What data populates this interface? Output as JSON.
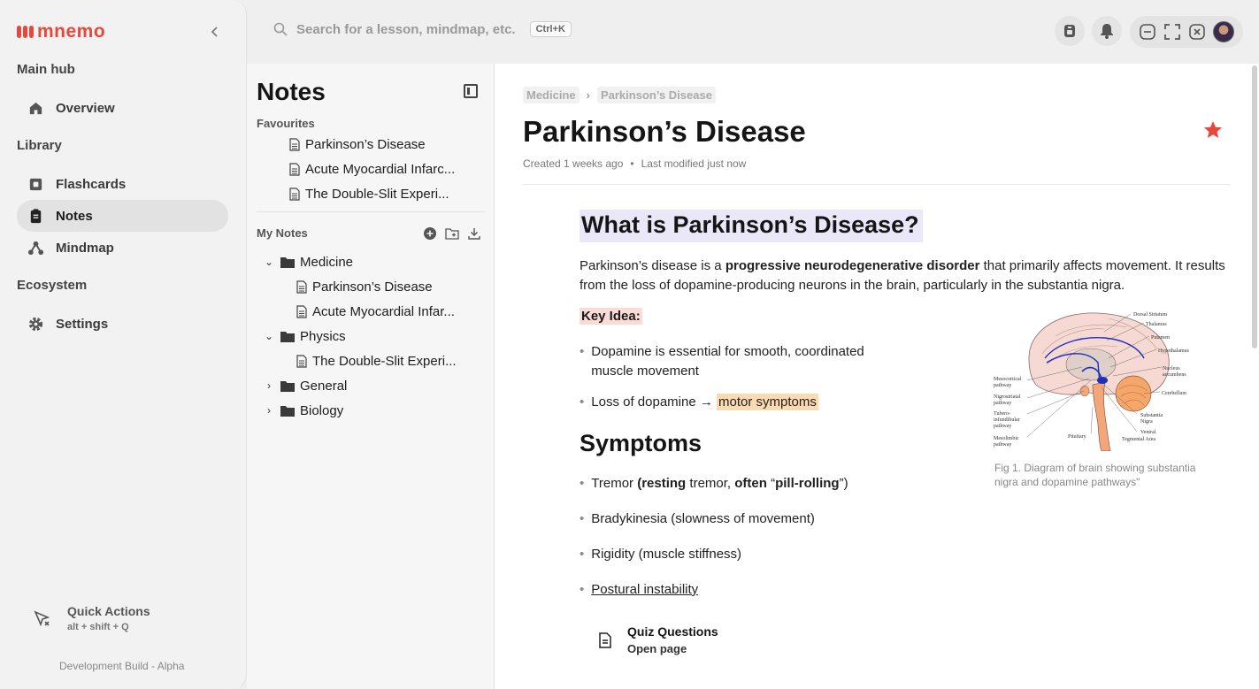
{
  "app": {
    "brand": "mnemo",
    "build": "Development Build - Alpha"
  },
  "sidebar": {
    "sections": [
      {
        "label": "Main hub",
        "items": [
          {
            "label": "Overview",
            "icon": "home-icon"
          }
        ]
      },
      {
        "label": "Library",
        "items": [
          {
            "label": "Flashcards",
            "icon": "flashcard-icon"
          },
          {
            "label": "Notes",
            "icon": "clipboard-icon",
            "active": true
          },
          {
            "label": "Mindmap",
            "icon": "mindmap-icon"
          }
        ]
      },
      {
        "label": "Ecosystem",
        "items": [
          {
            "label": "Settings",
            "icon": "gear-icon"
          }
        ]
      }
    ],
    "quick_actions": {
      "title": "Quick Actions",
      "shortcut": "alt + shift + Q"
    }
  },
  "topbar": {
    "search_placeholder": "Search for a lesson, mindmap, etc.",
    "search_shortcut": "Ctrl+K"
  },
  "notes_panel": {
    "title": "Notes",
    "favourites_label": "Favourites",
    "favourites": [
      "Parkinson’s Disease",
      "Acute Myocardial Infarc...",
      "The Double-Slit Experi..."
    ],
    "my_notes_label": "My Notes",
    "tree": [
      {
        "type": "folder",
        "label": "Medicine",
        "expanded": true
      },
      {
        "type": "note",
        "label": "Parkinson’s Disease"
      },
      {
        "type": "note",
        "label": "Acute Myocardial Infar..."
      },
      {
        "type": "folder",
        "label": "Physics",
        "expanded": true
      },
      {
        "type": "note",
        "label": "The Double-Slit Experi..."
      },
      {
        "type": "folder",
        "label": "General",
        "expanded": false
      },
      {
        "type": "folder",
        "label": "Biology",
        "expanded": false
      }
    ]
  },
  "document": {
    "breadcrumbs": [
      "Medicine",
      "Parkinson’s Disease"
    ],
    "title": "Parkinson’s Disease",
    "created": "Created 1 weeks ago",
    "modified": "Last modified just now",
    "heading1": "What is Parkinson’s Disease?",
    "intro_pre": "Parkinson’s disease is a ",
    "intro_bold": "progressive neurodegenerative disorder",
    "intro_post": " that primarily affects movement. It results from the loss of dopamine-producing neurons in the brain, particularly in the substantia nigra.",
    "key_idea": "Key Idea:",
    "key_bullets": {
      "b1": "Dopamine is essential for smooth, coordinated muscle movement",
      "b2_pre": "Loss of dopamine → ",
      "b2_hl": "motor symptoms"
    },
    "heading2": "Symptoms",
    "symptoms": {
      "s1_a": "Tremor ",
      "s1_b": "(resting",
      "s1_c": " tremor, ",
      "s1_d": "often",
      "s1_e": " “",
      "s1_f": "pill-rolling",
      "s1_g": "”)",
      "s2": "Bradykinesia (slowness of movement)",
      "s3": "Rigidity (muscle stiffness)",
      "s4": "Postural instability"
    },
    "quiz": {
      "title": "Quiz Questions",
      "subtitle": "Open page"
    },
    "figure_caption": "Fig 1. Diagram of brain showing substantia nigra and dopamine pathways\"",
    "figure_labels": {
      "dorsal_striatum": "Dorsal Striatum",
      "thalamus": "Thalamus",
      "putamen": "Putamen",
      "hypothalamus": "Hypothalamus",
      "nucleus": "Nucleus",
      "accumbens": "accumbens",
      "cerebellum": "Cerebellum",
      "mesocortical": "Mesocortical",
      "mesocortical2": "pathway",
      "nigrostriatal": "Nigrostriatal",
      "nigrostriatal2": "pathway",
      "tubero": "Tubero-",
      "tubero2": "infundibular",
      "tubero3": "pathway",
      "mesolimbic": "Mesolimbic",
      "mesolimbic2": "pathway",
      "pituitary": "Pituitary",
      "substantia": "Substantia",
      "nigra": "Nigra",
      "ventral": "Ventral",
      "tegmental": "Tegmental Area"
    }
  },
  "colors": {
    "brand": "#e8483b",
    "heading_highlight": "#e9e7f8",
    "key_highlight": "#fadbd5",
    "motor_highlight": "#fbd9b1",
    "star": "#e8483b"
  }
}
